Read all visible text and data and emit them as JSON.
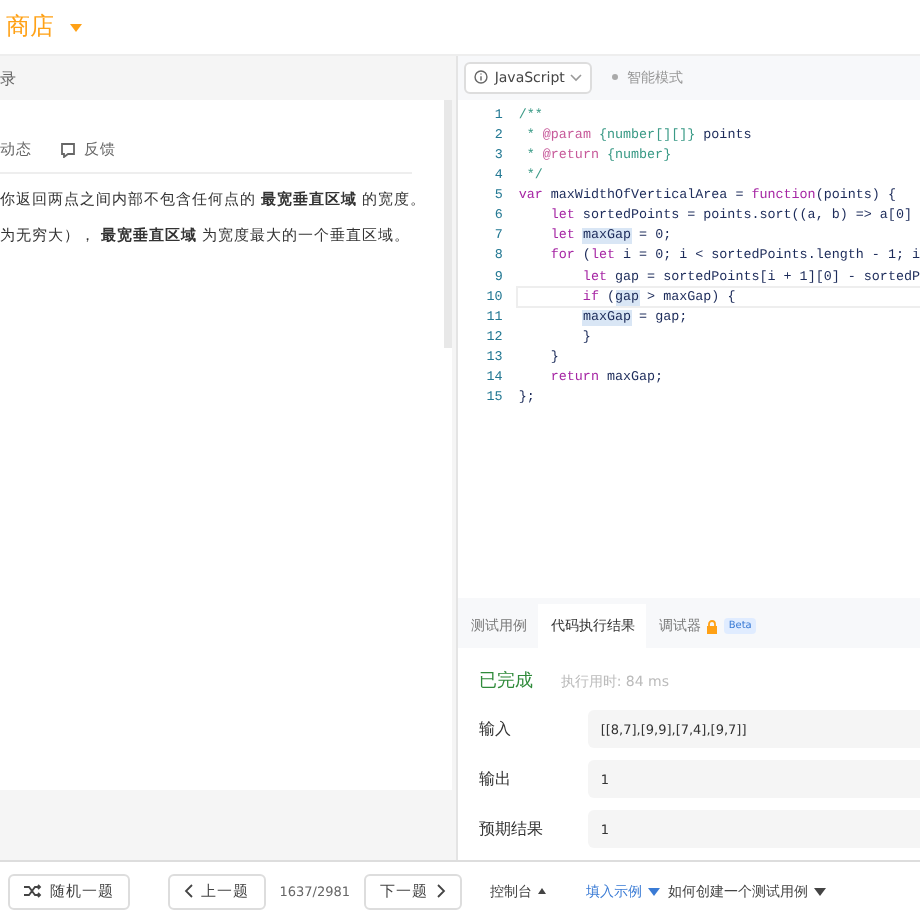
{
  "header": {
    "title": "商店"
  },
  "left_tabs": {
    "label": "录"
  },
  "description": {
    "actions": [
      {
        "kind": "text",
        "label": "动态"
      },
      {
        "kind": "feedback",
        "label": "反馈"
      }
    ],
    "paragraphs": [
      "你返回两点之间内部不包含任何点的 **最宽垂直区域** 的宽度。",
      "为无穷大）， **最宽垂直区域** 为宽度最大的一个垂直区域。"
    ]
  },
  "editor": {
    "language": "JavaScript",
    "mode": "智能模式",
    "lines": [
      {
        "number": "1",
        "current": false,
        "tokens": [
          {
            "kind": "comment",
            "text": "/**"
          }
        ]
      },
      {
        "number": "2",
        "current": false,
        "tokens": [
          {
            "kind": "comment",
            "text": " * "
          },
          {
            "kind": "tag",
            "text": "@param"
          },
          {
            "kind": "comment",
            "text": " {number[][]} "
          },
          {
            "kind": "plain",
            "text": "points"
          }
        ]
      },
      {
        "number": "3",
        "current": false,
        "tokens": [
          {
            "kind": "comment",
            "text": " * "
          },
          {
            "kind": "tag",
            "text": "@return"
          },
          {
            "kind": "comment",
            "text": " {number}"
          }
        ]
      },
      {
        "number": "4",
        "current": false,
        "tokens": [
          {
            "kind": "comment",
            "text": " */"
          }
        ]
      },
      {
        "number": "5",
        "current": false,
        "tokens": [
          {
            "kind": "keyword",
            "text": "var"
          },
          {
            "kind": "plain",
            "text": " maxWidthOfVerticalArea = "
          },
          {
            "kind": "keyword",
            "text": "function"
          },
          {
            "kind": "plain",
            "text": "(points) {"
          }
        ]
      },
      {
        "number": "6",
        "current": false,
        "tokens": [
          {
            "kind": "keyword",
            "text": "    let"
          },
          {
            "kind": "plain",
            "text": " sortedPoints = points.sort((a, b) => a[0]"
          }
        ]
      },
      {
        "number": "7",
        "current": false,
        "tokens": [
          {
            "kind": "keyword",
            "text": "    let"
          },
          {
            "kind": "match",
            "text": " maxGap"
          },
          {
            "kind": "plain",
            "text": " = 0;"
          }
        ]
      },
      {
        "number": "8",
        "current": false,
        "tokens": [
          {
            "kind": "keyword",
            "text": "    for"
          },
          {
            "kind": "plain",
            "text": " ("
          },
          {
            "kind": "keyword",
            "text": "let"
          },
          {
            "kind": "plain",
            "text": " i = 0; i < sortedPoints.length - 1; i"
          }
        ]
      },
      {
        "number": "9",
        "current": false,
        "tokens": [
          {
            "kind": "keyword",
            "text": "        let"
          },
          {
            "kind": "plain",
            "text": " gap = sortedPoints[i + 1][0] - sortedP"
          }
        ]
      },
      {
        "number": "10",
        "current": true,
        "tokens": [
          {
            "kind": "keyword",
            "text": "        if"
          },
          {
            "kind": "plain",
            "text": " ("
          },
          {
            "kind": "match",
            "text": "gap"
          },
          {
            "kind": "plain",
            "text": " > maxGap) {"
          }
        ]
      },
      {
        "number": "11",
        "current": false,
        "tokens": [
          {
            "kind": "match",
            "text": "        maxGap"
          },
          {
            "kind": "plain",
            "text": " = gap;"
          }
        ]
      },
      {
        "number": "12",
        "current": false,
        "tokens": [
          {
            "kind": "plain",
            "text": "        }"
          }
        ]
      },
      {
        "number": "13",
        "current": false,
        "tokens": [
          {
            "kind": "plain",
            "text": "    }"
          }
        ]
      },
      {
        "number": "14",
        "current": false,
        "tokens": [
          {
            "kind": "keyword",
            "text": "    return"
          },
          {
            "kind": "plain",
            "text": " maxGap;"
          }
        ]
      },
      {
        "number": "15",
        "current": false,
        "tokens": [
          {
            "kind": "plain",
            "text": "};"
          }
        ]
      }
    ]
  },
  "result": {
    "tabs": [
      {
        "label": "测试用例",
        "selected": false
      },
      {
        "label": "代码执行结果",
        "selected": true
      },
      {
        "label": "调试器",
        "selected": false,
        "locked": true,
        "badge": "Beta"
      }
    ],
    "status": "已完成",
    "runtime": "执行用时: 84 ms",
    "rows": [
      {
        "label": "输入",
        "value": "[[8,7],[9,9],[7,4],[9,7]]"
      },
      {
        "label": "输出",
        "value": "1"
      },
      {
        "label": "预期结果",
        "value": "1"
      }
    ]
  },
  "footer": {
    "random": "随机一题",
    "prev": "上一题",
    "counter": "1637/2981",
    "next": "下一题",
    "console": "控制台",
    "fill_example": "填入示例",
    "howto": "如何创建一个测试用例"
  }
}
